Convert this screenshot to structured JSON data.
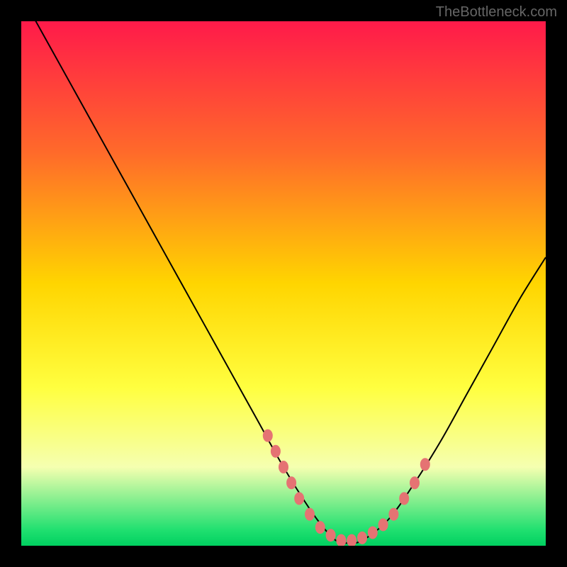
{
  "watermark": "TheBottleneck.com",
  "chart_data": {
    "type": "line",
    "title": "",
    "xlabel": "",
    "ylabel": "",
    "xlim": [
      0,
      100
    ],
    "ylim": [
      0,
      100
    ],
    "gradient_stops": [
      {
        "offset": 0,
        "color": "#ff1a4a"
      },
      {
        "offset": 25,
        "color": "#ff6a2a"
      },
      {
        "offset": 50,
        "color": "#ffd500"
      },
      {
        "offset": 70,
        "color": "#ffff40"
      },
      {
        "offset": 85,
        "color": "#f5ffb0"
      },
      {
        "offset": 97,
        "color": "#20e070"
      },
      {
        "offset": 100,
        "color": "#00d060"
      }
    ],
    "series": [
      {
        "name": "bottleneck-curve",
        "x": [
          0,
          5,
          10,
          15,
          20,
          25,
          30,
          35,
          40,
          45,
          50,
          55,
          58,
          60,
          62,
          65,
          70,
          75,
          80,
          85,
          90,
          95,
          100
        ],
        "y": [
          105,
          96,
          87,
          78,
          69,
          60,
          51,
          42,
          33,
          24,
          15,
          7,
          3,
          1,
          0.5,
          1,
          5,
          12,
          20,
          29,
          38,
          47,
          55
        ]
      }
    ],
    "markers": {
      "name": "optimal-zone-dots",
      "color": "#e57373",
      "points": [
        {
          "x": 47,
          "y": 21
        },
        {
          "x": 48.5,
          "y": 18
        },
        {
          "x": 50,
          "y": 15
        },
        {
          "x": 51.5,
          "y": 12
        },
        {
          "x": 53,
          "y": 9
        },
        {
          "x": 55,
          "y": 6
        },
        {
          "x": 57,
          "y": 3.5
        },
        {
          "x": 59,
          "y": 2
        },
        {
          "x": 61,
          "y": 1
        },
        {
          "x": 63,
          "y": 1
        },
        {
          "x": 65,
          "y": 1.5
        },
        {
          "x": 67,
          "y": 2.5
        },
        {
          "x": 69,
          "y": 4
        },
        {
          "x": 71,
          "y": 6
        },
        {
          "x": 73,
          "y": 9
        },
        {
          "x": 75,
          "y": 12
        },
        {
          "x": 77,
          "y": 15.5
        }
      ]
    }
  }
}
